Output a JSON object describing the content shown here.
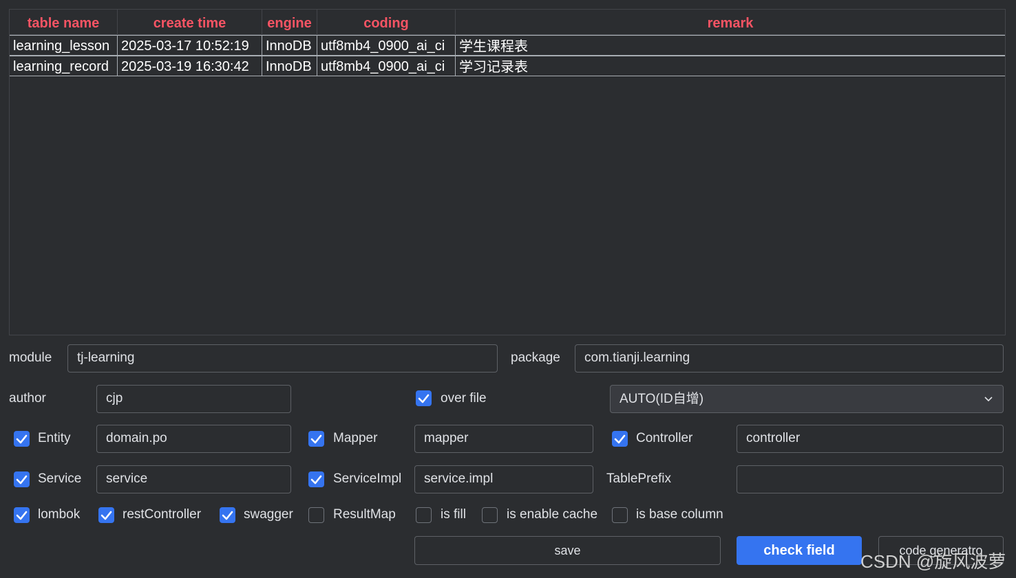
{
  "table": {
    "columns": [
      "table name",
      "create time",
      "engine",
      "coding",
      "remark"
    ],
    "rows": [
      [
        "learning_lesson",
        "2025-03-17 10:52:19",
        "InnoDB",
        "utf8mb4_0900_ai_ci",
        "学生课程表"
      ],
      [
        "learning_record",
        "2025-03-19 16:30:42",
        "InnoDB",
        "utf8mb4_0900_ai_ci",
        "学习记录表"
      ]
    ]
  },
  "form": {
    "module_label": "module",
    "module_value": "tj-learning",
    "package_label": "package",
    "package_value": "com.tianji.learning",
    "author_label": "author",
    "author_value": "cjp",
    "over_file_label": "over file",
    "over_file_checked": true,
    "id_type_selected": "AUTO(ID自增)",
    "entity_label": "Entity",
    "entity_value": "domain.po",
    "mapper_label": "Mapper",
    "mapper_value": "mapper",
    "controller_label": "Controller",
    "controller_value": "controller",
    "service_label": "Service",
    "service_value": "service",
    "serviceimpl_label": "ServiceImpl",
    "serviceimpl_value": "service.impl",
    "tableprefix_label": "TablePrefix",
    "tableprefix_value": "",
    "options": {
      "lombok": "lombok",
      "restController": "restController",
      "swagger": "swagger",
      "resultMap": "ResultMap",
      "isFill": "is fill",
      "isEnableCache": "is enable cache",
      "isBaseColumn": "is base column"
    }
  },
  "buttons": {
    "save": "save",
    "check_field": "check field",
    "code_generator": "code generatro"
  },
  "watermark": "CSDN @旋风波萝",
  "colors": {
    "background": "#2b2d30",
    "header_text": "#f75464",
    "accent": "#3574f0"
  }
}
